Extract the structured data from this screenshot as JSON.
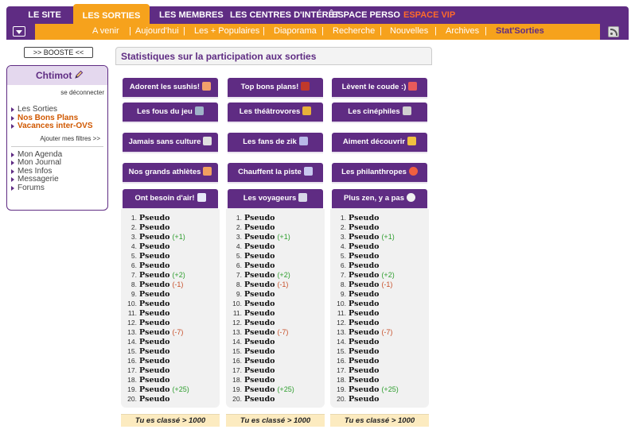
{
  "topnav": {
    "tabs": [
      {
        "label": "LE SITE"
      },
      {
        "label": "LES SORTIES"
      },
      {
        "label": "LES MEMBRES"
      },
      {
        "label": "LES CENTRES D'INTÉRÊT"
      },
      {
        "label": "ESPACE PERSO"
      },
      {
        "label": "ESPACE VIP"
      }
    ],
    "active_tab": "LES SORTIES"
  },
  "subnav": {
    "items": [
      {
        "label": "A venir"
      },
      {
        "label": "Aujourd'hui"
      },
      {
        "label": "Les + Populaires"
      },
      {
        "label": "Diaporama"
      },
      {
        "label": "Recherche"
      },
      {
        "label": "Nouvelles"
      },
      {
        "label": "Archives"
      },
      {
        "label": "Stat'Sorties"
      }
    ],
    "separator": "|",
    "current": "Stat'Sorties"
  },
  "sidebar": {
    "booste_label": ">> BOOSTE <<",
    "username": "Chtimot",
    "logout_label": "se déconnecter",
    "links": [
      {
        "label": "Les Sorties"
      },
      {
        "label": "Nos Bons Plans"
      },
      {
        "label": "Vacances inter-OVS"
      }
    ],
    "filters_label": "Ajouter mes filtres >>",
    "links2": [
      {
        "label": "Mon Agenda"
      },
      {
        "label": "Mon Journal"
      },
      {
        "label": "Mes Infos"
      },
      {
        "label": "Messagerie"
      },
      {
        "label": "Forums"
      }
    ]
  },
  "main": {
    "title": "Statistiques sur la participation aux sorties",
    "categories": [
      {
        "label": "Adorent les sushis!",
        "icon": "sushi-icon"
      },
      {
        "label": "Top bons plans!",
        "icon": "gift-icon"
      },
      {
        "label": "Lèvent le coude :)",
        "icon": "cocktail-icon"
      },
      {
        "label": "Les fous du jeu",
        "icon": "game-icon"
      },
      {
        "label": "Les théâtrovores",
        "icon": "theatre-icon"
      },
      {
        "label": "Les cinéphiles",
        "icon": "film-icon"
      },
      {
        "label": "Jamais sans culture",
        "icon": "museum-icon"
      },
      {
        "label": "Les fans de zik",
        "icon": "music-icon"
      },
      {
        "label": "Aiment découvrir",
        "icon": "crown-icon"
      },
      {
        "label": "Nos grands athlètes",
        "icon": "runner-icon"
      },
      {
        "label": "Chauffent la piste",
        "icon": "dancer-icon"
      },
      {
        "label": "Les philanthropes",
        "icon": "lifebuoy-icon"
      },
      {
        "label": "Ont besoin d'air!",
        "icon": "air-icon"
      },
      {
        "label": "Les voyageurs",
        "icon": "plane-icon"
      },
      {
        "label": "Plus zen, y a pas",
        "icon": "yinyang-icon"
      }
    ],
    "rankings": [
      {
        "rows": [
          {
            "n": "1.",
            "name": "Pseudo",
            "delta": ""
          },
          {
            "n": "2.",
            "name": "Pseudo",
            "delta": ""
          },
          {
            "n": "3.",
            "name": "Pseudo",
            "delta": "(+1)"
          },
          {
            "n": "4.",
            "name": "Pseudo",
            "delta": ""
          },
          {
            "n": "5.",
            "name": "Pseudo",
            "delta": ""
          },
          {
            "n": "6.",
            "name": "Pseudo",
            "delta": ""
          },
          {
            "n": "7.",
            "name": "Pseudo",
            "delta": "(+2)"
          },
          {
            "n": "8.",
            "name": "Pseudo",
            "delta": "(-1)"
          },
          {
            "n": "9.",
            "name": "Pseudo",
            "delta": ""
          },
          {
            "n": "10.",
            "name": "Pseudo",
            "delta": ""
          },
          {
            "n": "11.",
            "name": "Pseudo",
            "delta": ""
          },
          {
            "n": "12.",
            "name": "Pseudo",
            "delta": ""
          },
          {
            "n": "13.",
            "name": "Pseudo",
            "delta": "(-7)"
          },
          {
            "n": "14.",
            "name": "Pseudo",
            "delta": ""
          },
          {
            "n": "15.",
            "name": "Pseudo",
            "delta": ""
          },
          {
            "n": "16.",
            "name": "Pseudo",
            "delta": ""
          },
          {
            "n": "17.",
            "name": "Pseudo",
            "delta": ""
          },
          {
            "n": "18.",
            "name": "Pseudo",
            "delta": ""
          },
          {
            "n": "19.",
            "name": "Pseudo",
            "delta": "(+25)"
          },
          {
            "n": "20.",
            "name": "Pseudo",
            "delta": ""
          }
        ],
        "rank_label": "Tu es classé > 1000"
      },
      {
        "rows": [
          {
            "n": "1.",
            "name": "Pseudo",
            "delta": ""
          },
          {
            "n": "2.",
            "name": "Pseudo",
            "delta": ""
          },
          {
            "n": "3.",
            "name": "Pseudo",
            "delta": "(+1)"
          },
          {
            "n": "4.",
            "name": "Pseudo",
            "delta": ""
          },
          {
            "n": "5.",
            "name": "Pseudo",
            "delta": ""
          },
          {
            "n": "6.",
            "name": "Pseudo",
            "delta": ""
          },
          {
            "n": "7.",
            "name": "Pseudo",
            "delta": "(+2)"
          },
          {
            "n": "8.",
            "name": "Pseudo",
            "delta": "(-1)"
          },
          {
            "n": "9.",
            "name": "Pseudo",
            "delta": ""
          },
          {
            "n": "10.",
            "name": "Pseudo",
            "delta": ""
          },
          {
            "n": "11.",
            "name": "Pseudo",
            "delta": ""
          },
          {
            "n": "12.",
            "name": "Pseudo",
            "delta": ""
          },
          {
            "n": "13.",
            "name": "Pseudo",
            "delta": "(-7)"
          },
          {
            "n": "14.",
            "name": "Pseudo",
            "delta": ""
          },
          {
            "n": "15.",
            "name": "Pseudo",
            "delta": ""
          },
          {
            "n": "16.",
            "name": "Pseudo",
            "delta": ""
          },
          {
            "n": "17.",
            "name": "Pseudo",
            "delta": ""
          },
          {
            "n": "18.",
            "name": "Pseudo",
            "delta": ""
          },
          {
            "n": "19.",
            "name": "Pseudo",
            "delta": "(+25)"
          },
          {
            "n": "20.",
            "name": "Pseudo",
            "delta": ""
          }
        ],
        "rank_label": "Tu es classé > 1000"
      },
      {
        "rows": [
          {
            "n": "1.",
            "name": "Pseudo",
            "delta": ""
          },
          {
            "n": "2.",
            "name": "Pseudo",
            "delta": ""
          },
          {
            "n": "3.",
            "name": "Pseudo",
            "delta": "(+1)"
          },
          {
            "n": "4.",
            "name": "Pseudo",
            "delta": ""
          },
          {
            "n": "5.",
            "name": "Pseudo",
            "delta": ""
          },
          {
            "n": "6.",
            "name": "Pseudo",
            "delta": ""
          },
          {
            "n": "7.",
            "name": "Pseudo",
            "delta": "(+2)"
          },
          {
            "n": "8.",
            "name": "Pseudo",
            "delta": "(-1)"
          },
          {
            "n": "9.",
            "name": "Pseudo",
            "delta": ""
          },
          {
            "n": "10.",
            "name": "Pseudo",
            "delta": ""
          },
          {
            "n": "11.",
            "name": "Pseudo",
            "delta": ""
          },
          {
            "n": "12.",
            "name": "Pseudo",
            "delta": ""
          },
          {
            "n": "13.",
            "name": "Pseudo",
            "delta": "(-7)"
          },
          {
            "n": "14.",
            "name": "Pseudo",
            "delta": ""
          },
          {
            "n": "15.",
            "name": "Pseudo",
            "delta": ""
          },
          {
            "n": "16.",
            "name": "Pseudo",
            "delta": ""
          },
          {
            "n": "17.",
            "name": "Pseudo",
            "delta": ""
          },
          {
            "n": "18.",
            "name": "Pseudo",
            "delta": ""
          },
          {
            "n": "19.",
            "name": "Pseudo",
            "delta": "(+25)"
          },
          {
            "n": "20.",
            "name": "Pseudo",
            "delta": ""
          }
        ],
        "rank_label": "Tu es classé > 1000"
      }
    ]
  },
  "colors": {
    "primary": "#5f2c83",
    "accent": "#f6a21c",
    "vip": "#ff6a2a",
    "positive": "#2e9e2e",
    "negative": "#c8502a"
  }
}
